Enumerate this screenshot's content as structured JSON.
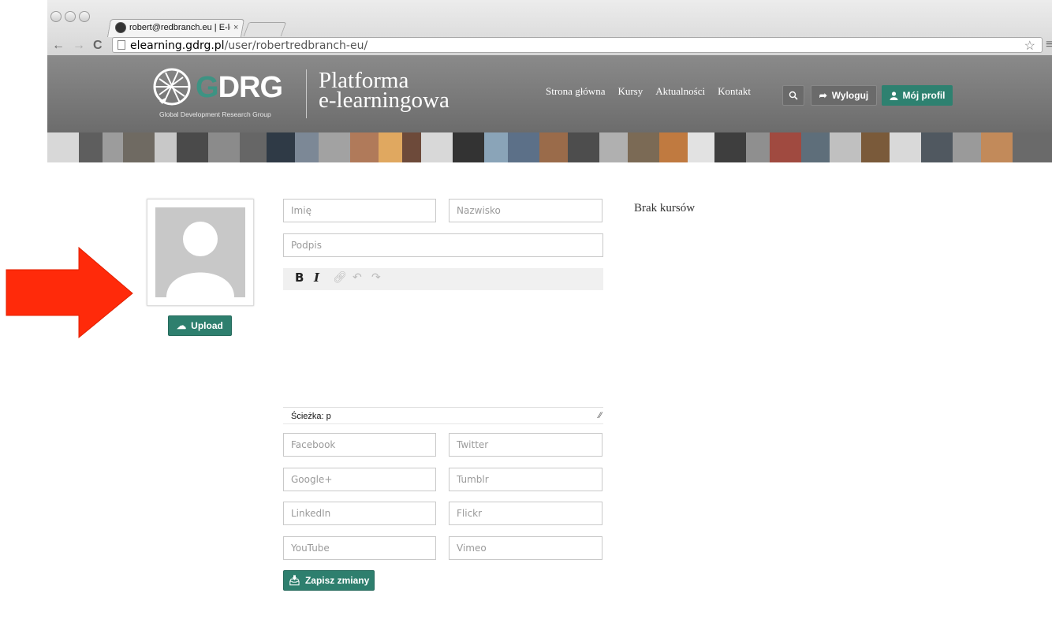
{
  "browser": {
    "tab_title": "robert@redbranch.eu | E-le",
    "tab_close": "×",
    "url_host": "elearning.gdrg.pl",
    "url_path": "/user/robertredbranch-eu/"
  },
  "header": {
    "logo_text_g": "G",
    "logo_text_rest": "DRG",
    "logo_subtitle": "Global Development Research Group",
    "platform_line1": "Platforma",
    "platform_line2": "e-learningowa",
    "nav": [
      "Strona główna",
      "Kursy",
      "Aktualności",
      "Kontakt"
    ],
    "logout_label": "Wyloguj",
    "profile_label": "Mój profil"
  },
  "profile": {
    "upload_label": "Upload",
    "first_name_placeholder": "Imię",
    "last_name_placeholder": "Nazwisko",
    "signature_placeholder": "Podpis",
    "editor_bold": "B",
    "editor_italic": "I",
    "editor_path": "Ścieżka: p",
    "facebook_placeholder": "Facebook",
    "twitter_placeholder": "Twitter",
    "google_placeholder": "Google+",
    "tumblr_placeholder": "Tumblr",
    "linkedin_placeholder": "LinkedIn",
    "flickr_placeholder": "Flickr",
    "youtube_placeholder": "YouTube",
    "vimeo_placeholder": "Vimeo",
    "save_label": "Zapisz zmiany",
    "no_courses": "Brak kursów"
  },
  "colors": {
    "accent": "#2e7f6e",
    "header_bg": "#7a7a7a",
    "arrow": "#ff2a0a"
  }
}
